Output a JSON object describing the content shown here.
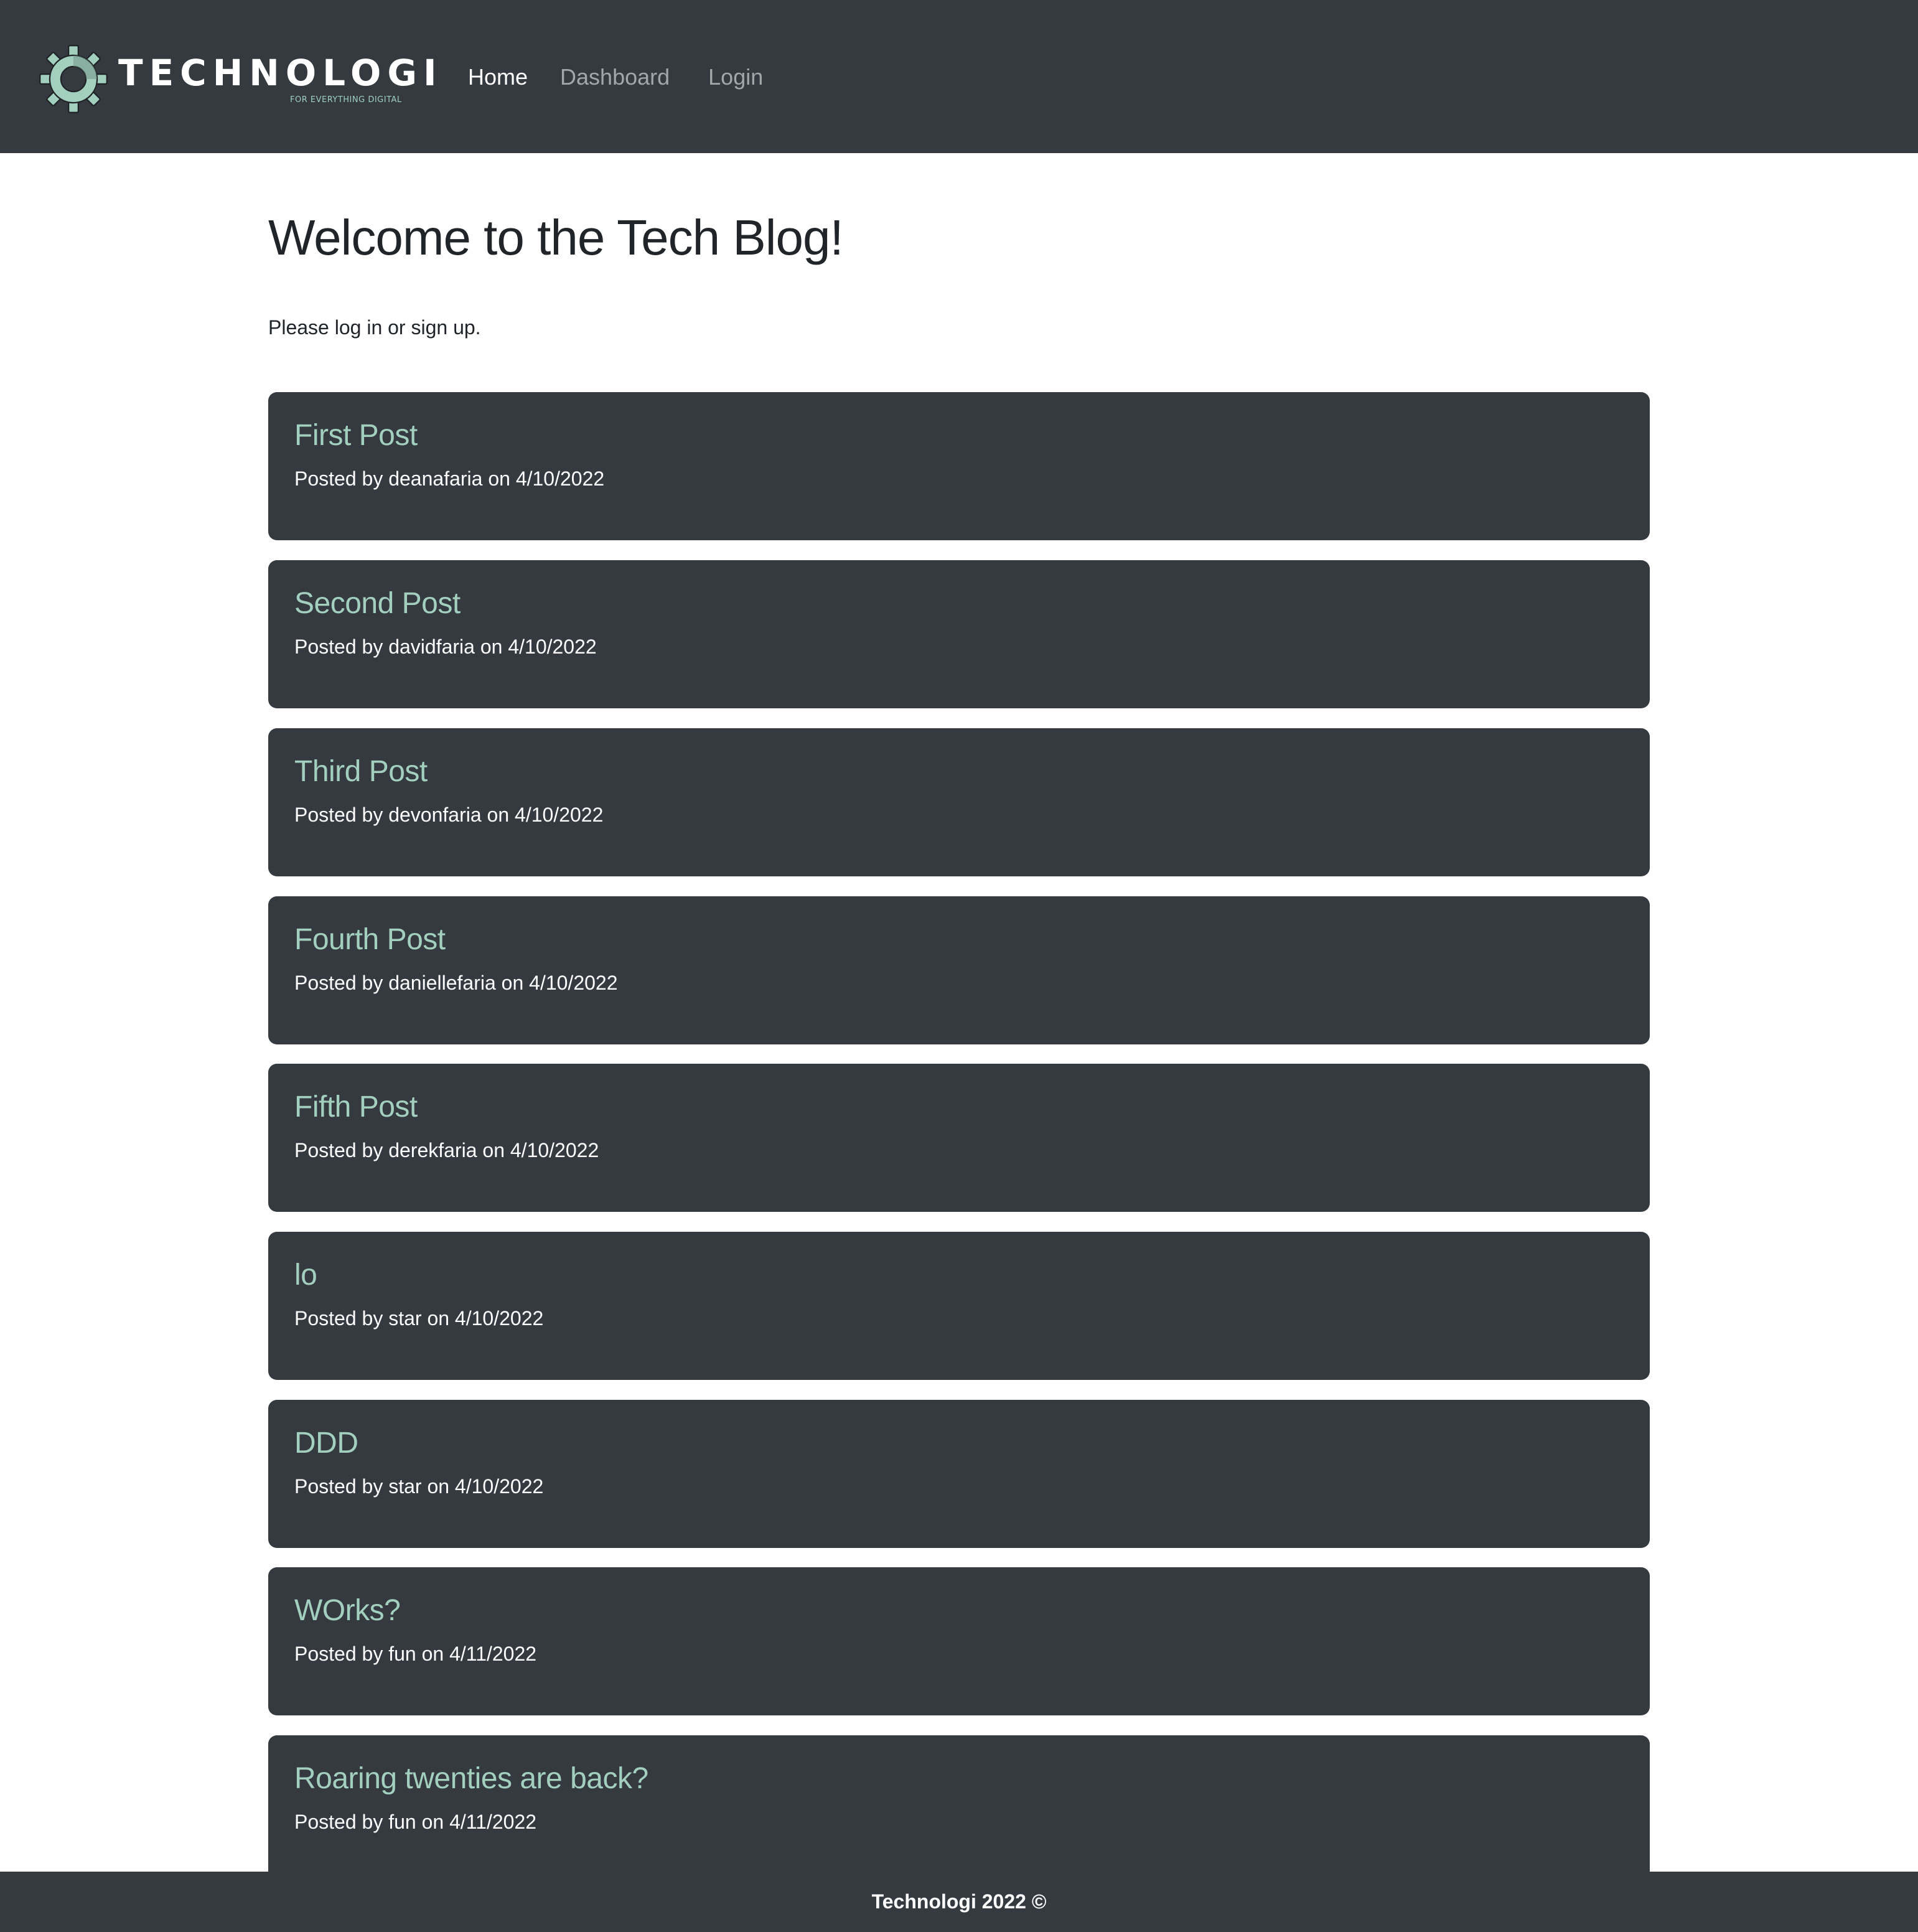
{
  "navbar": {
    "brand": {
      "name": "TECHNOLOGI",
      "tagline": "FOR EVERYTHING DIGITAL",
      "icon": "gear-logo-icon"
    },
    "links": [
      {
        "label": "Home",
        "active": true
      },
      {
        "label": "Dashboard",
        "active": false
      },
      {
        "label": "Login",
        "active": false
      }
    ]
  },
  "main": {
    "title": "Welcome to the Tech Blog!",
    "subtitle": "Please log in or sign up."
  },
  "posts": [
    {
      "title": "First Post",
      "meta": "Posted by deanafaria on 4/10/2022"
    },
    {
      "title": "Second Post",
      "meta": "Posted by davidfaria on 4/10/2022"
    },
    {
      "title": "Third Post",
      "meta": "Posted by devonfaria on 4/10/2022"
    },
    {
      "title": "Fourth Post",
      "meta": "Posted by daniellefaria on 4/10/2022"
    },
    {
      "title": "Fifth Post",
      "meta": "Posted by derekfaria on 4/10/2022"
    },
    {
      "title": "lo",
      "meta": "Posted by star on 4/10/2022"
    },
    {
      "title": "DDD",
      "meta": "Posted by star on 4/10/2022"
    },
    {
      "title": "WOrks?",
      "meta": "Posted by fun on 4/11/2022"
    },
    {
      "title": "Roaring twenties are back?",
      "meta": "Posted by fun on 4/11/2022"
    }
  ],
  "footer": {
    "text": "Technologi 2022 ©"
  },
  "colors": {
    "dark": "#343a40",
    "accent": "#a3cfbf",
    "text": "#212529"
  }
}
